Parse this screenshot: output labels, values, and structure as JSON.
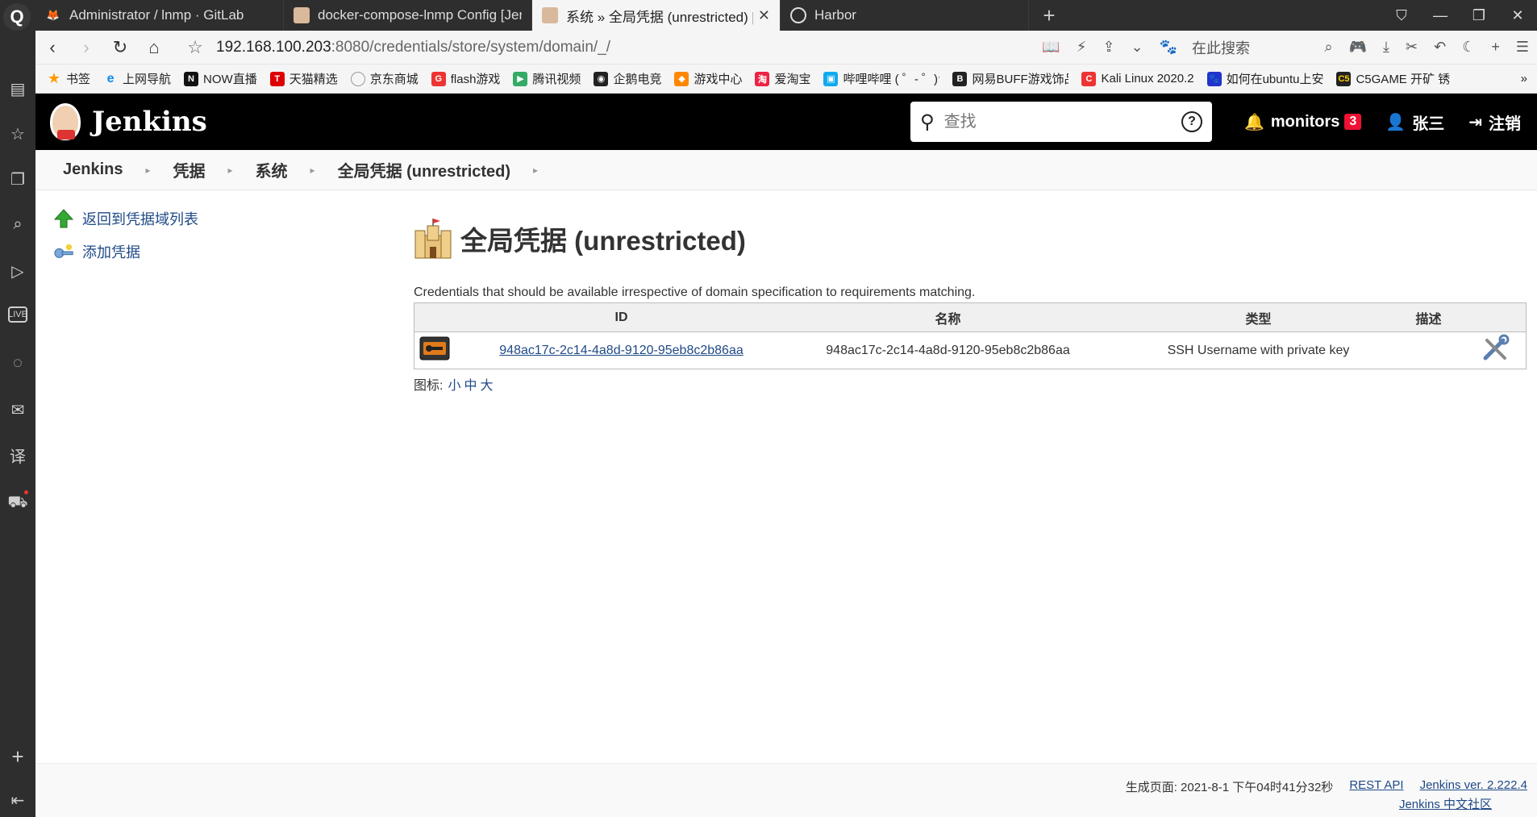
{
  "browser": {
    "tabs": [
      {
        "title": "Administrator / lnmp · GitLab",
        "active": false
      },
      {
        "title": "docker-compose-lnmp Config [Jenkins]",
        "active": false
      },
      {
        "title": "系统 » 全局凭据 (unrestricted) [Jenkins]",
        "active": true
      },
      {
        "title": "Harbor",
        "active": false
      }
    ],
    "url_host": "192.168.100.203",
    "url_rest": ":8080/credentials/store/system/domain/_/",
    "search_placeholder": "在此搜索",
    "bookmarks": [
      "书签",
      "上网导航",
      "NOW直播",
      "天猫精选",
      "京东商城",
      "flash游戏",
      "腾讯视频",
      "企鹅电竞",
      "游戏中心",
      "爱淘宝",
      "哔哩哔哩 ( ゜- ゜)つ",
      "网易BUFF游戏饰品",
      "Kali Linux 2020.2",
      "如何在ubuntu上安",
      "C5GAME 开矿 锈"
    ]
  },
  "header": {
    "logo_text": "Jenkins",
    "search_placeholder": "查找",
    "monitors_label": "monitors",
    "monitors_count": "3",
    "user_name": "张三",
    "logout_label": "注销"
  },
  "breadcrumb": [
    "Jenkins",
    "凭据",
    "系统",
    "全局凭据 (unrestricted)"
  ],
  "side": {
    "back_label": "返回到凭据域列表",
    "add_label": "添加凭据"
  },
  "main": {
    "title": "全局凭据 (unrestricted)",
    "description": "Credentials that should be available irrespective of domain specification to requirements matching.",
    "columns": {
      "id": "ID",
      "name": "名称",
      "type": "类型",
      "desc": "描述"
    },
    "rows": [
      {
        "id": "948ac17c-2c14-4a8d-9120-95eb8c2b86aa",
        "name": "948ac17c-2c14-4a8d-9120-95eb8c2b86aa",
        "type": "SSH Username with private key"
      }
    ],
    "icon_label": "图标:",
    "icon_sizes": {
      "small": "小",
      "medium": "中",
      "large": "大"
    }
  },
  "footer": {
    "generated": "生成页面: 2021-8-1 下午04时41分32秒",
    "rest_api": "REST API",
    "version": "Jenkins ver. 2.222.4",
    "community": "Jenkins 中文社区"
  }
}
